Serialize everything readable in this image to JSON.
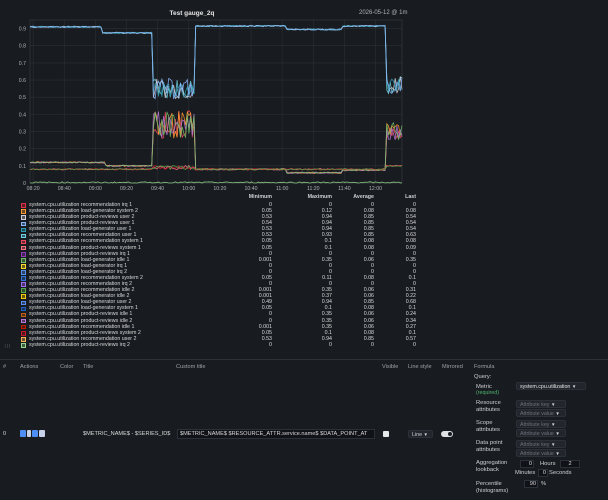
{
  "chart": {
    "title": "Test gauge_2q",
    "timestamp": "2026-05-12 @ 1m",
    "y_ticks": [
      "0.9",
      "0.8",
      "0.7",
      "0.6",
      "0.5",
      "0.4",
      "0.3",
      "0.2",
      "0.1",
      "0"
    ],
    "x_ticks": [
      "08:20",
      "08:40",
      "09:00",
      "09:20",
      "09:40",
      "10:00",
      "10:20",
      "10:40",
      "11:00",
      "11:20",
      "11:40",
      "12:00"
    ]
  },
  "chart_data": {
    "type": "line",
    "title": "Test gauge_2q",
    "x": [
      "08:20",
      "08:40",
      "09:00",
      "09:20",
      "09:40",
      "10:00",
      "10:20",
      "10:40",
      "11:00",
      "11:20",
      "11:40",
      "12:00"
    ],
    "ylim": [
      0,
      0.95
    ],
    "grid": true,
    "series": [
      {
        "name": "system.cpu.utilization recommendation user 1",
        "color": "#6ed0e0",
        "profile": "high"
      },
      {
        "name": "system.cpu.utilization product-reviews user 2",
        "color": "#cfcfd8",
        "profile": "high"
      },
      {
        "name": "system.cpu.utilization load-generator user 1",
        "color": "#2a9bb0",
        "profile": "high"
      },
      {
        "name": "system.cpu.utilization product-reviews user 1",
        "color": "#8ab8ff",
        "profile": "high"
      },
      {
        "name": "system.cpu.utilization recommendation system 1",
        "color": "#f2495c",
        "profile": "mid"
      },
      {
        "name": "system.cpu.utilization load-generator system 2",
        "color": "#ff9830",
        "profile": "mid"
      },
      {
        "name": "system.cpu.utilization product-reviews idle 2",
        "color": "#b877d9",
        "profile": "mid"
      },
      {
        "name": "system.cpu.utilization load-generator idle 1",
        "color": "#73bf69",
        "profile": "mid"
      },
      {
        "name": "system.cpu.utilization product-reviews system 1",
        "color": "#ff7383",
        "profile": "low"
      },
      {
        "name": "system.cpu.utilization product-reviews system 2",
        "color": "#c4162a",
        "profile": "low"
      },
      {
        "name": "system.cpu.utilization recommendation idle 2",
        "color": "#56a64b",
        "profile": "low"
      },
      {
        "name": "system.cpu.utilization product-reviews irq 2",
        "color": "#96d98d",
        "profile": "zero"
      }
    ]
  },
  "legend": {
    "headers": {
      "min": "Minimum",
      "max": "Maximum",
      "avg": "Average",
      "last": "Last"
    },
    "rows": [
      {
        "name": "system.cpu.utilization recommendation irq 1",
        "color": "#e02f44",
        "min": "0",
        "max": "0",
        "avg": "0",
        "last": "0"
      },
      {
        "name": "system.cpu.utilization load-generator system 2",
        "color": "#ff9830",
        "min": "0.05",
        "max": "0.12",
        "avg": "0.08",
        "last": "0.08"
      },
      {
        "name": "system.cpu.utilization product-reviews user 2",
        "color": "#cfcfd8",
        "min": "0.53",
        "max": "0.94",
        "avg": "0.85",
        "last": "0.54"
      },
      {
        "name": "system.cpu.utilization product-reviews user 1",
        "color": "#8ab8ff",
        "min": "0.54",
        "max": "0.94",
        "avg": "0.85",
        "last": "0.54"
      },
      {
        "name": "system.cpu.utilization load-generator user 1",
        "color": "#2a9bb0",
        "min": "0.53",
        "max": "0.94",
        "avg": "0.85",
        "last": "0.54"
      },
      {
        "name": "system.cpu.utilization recommendation user 1",
        "color": "#6ed0e0",
        "min": "0.53",
        "max": "0.93",
        "avg": "0.85",
        "last": "0.63"
      },
      {
        "name": "system.cpu.utilization recommendation system 1",
        "color": "#f2495c",
        "min": "0.05",
        "max": "0.1",
        "avg": "0.08",
        "last": "0.08"
      },
      {
        "name": "system.cpu.utilization product-reviews system 1",
        "color": "#ff7383",
        "min": "0.05",
        "max": "0.1",
        "avg": "0.08",
        "last": "0.09"
      },
      {
        "name": "system.cpu.utilization product-reviews irq 1",
        "color": "#8f3bb8",
        "min": "0",
        "max": "0",
        "avg": "0",
        "last": "0"
      },
      {
        "name": "system.cpu.utilization load-generator idle 1",
        "color": "#73bf69",
        "min": "0.001",
        "max": "0.35",
        "avg": "0.06",
        "last": "0.35"
      },
      {
        "name": "system.cpu.utilization load-generator irq 1",
        "color": "#fade2a",
        "min": "0",
        "max": "0",
        "avg": "0",
        "last": "0"
      },
      {
        "name": "system.cpu.utilization load-generator irq 2",
        "color": "#5794f2",
        "min": "0",
        "max": "0",
        "avg": "0",
        "last": "0"
      },
      {
        "name": "system.cpu.utilization recommendation system 2",
        "color": "#3274d9",
        "min": "0.05",
        "max": "0.11",
        "avg": "0.08",
        "last": "0.1"
      },
      {
        "name": "system.cpu.utilization recommendation irq 2",
        "color": "#a16efa",
        "min": "0",
        "max": "0",
        "avg": "0",
        "last": "0"
      },
      {
        "name": "system.cpu.utilization recommendation idle 2",
        "color": "#56a64b",
        "min": "0.001",
        "max": "0.35",
        "avg": "0.06",
        "last": "0.31"
      },
      {
        "name": "system.cpu.utilization load-generator idle 2",
        "color": "#f2cc0c",
        "min": "0.001",
        "max": "0.37",
        "avg": "0.06",
        "last": "0.22"
      },
      {
        "name": "system.cpu.utilization load-generator user 2",
        "color": "#5a8ff5",
        "min": "0.49",
        "max": "0.94",
        "avg": "0.85",
        "last": "0.68"
      },
      {
        "name": "system.cpu.utilization load-generator system 1",
        "color": "#1f60c4",
        "min": "0.05",
        "max": "0.1",
        "avg": "0.08",
        "last": "0.1"
      },
      {
        "name": "system.cpu.utilization product-reviews idle 1",
        "color": "#c15c17",
        "min": "0",
        "max": "0.35",
        "avg": "0.06",
        "last": "0.24"
      },
      {
        "name": "system.cpu.utilization product-reviews idle 2",
        "color": "#b877d9",
        "min": "0",
        "max": "0.35",
        "avg": "0.06",
        "last": "0.34"
      },
      {
        "name": "system.cpu.utilization recommendation idle 1",
        "color": "#bf1b00",
        "min": "0.001",
        "max": "0.35",
        "avg": "0.06",
        "last": "0.27"
      },
      {
        "name": "system.cpu.utilization product-reviews system 2",
        "color": "#c4162a",
        "min": "0.05",
        "max": "0.1",
        "avg": "0.08",
        "last": "0.1"
      },
      {
        "name": "system.cpu.utilization recommendation user 2",
        "color": "#ffb357",
        "min": "0.53",
        "max": "0.94",
        "avg": "0.85",
        "last": "0.57"
      },
      {
        "name": "system.cpu.utilization product-reviews irq 2",
        "color": "#96d98d",
        "min": "0",
        "max": "0",
        "avg": "0",
        "last": "0"
      }
    ]
  },
  "queries": {
    "headers": {
      "num": "#",
      "actions": "Actions",
      "color": "Color",
      "title": "Title",
      "custom_title": "Custom title",
      "visible": "Visible",
      "line_style": "Line style",
      "mirrored": "Mirrored",
      "formula": "Formula"
    },
    "row": {
      "index": "0",
      "title": "$METRIC_NAME$ - $SERIES_ID$",
      "custom_title": "$METRIC_NAME$ $RESOURCE_ATTR.service.name$ $DATA_POINT_AT",
      "line_style": "Line",
      "query_label": "Query:",
      "metric_label": "Metric",
      "metric_required": "(required)",
      "metric_value": "system.cpu.utilization",
      "resource_attr_label": "Resource attributes",
      "scope_attr_label": "Scope attributes",
      "datapoint_attr_label": "Data point attributes",
      "attr_key_placeholder": "Attribute key",
      "attr_value_placeholder": "Attribute value",
      "agg_label": "Aggregation lookback",
      "hours_value": "0",
      "hours_label": "Hours",
      "minutes_value": "2",
      "minutes_label": "Minutes",
      "seconds_value": "0",
      "seconds_label": "Seconds",
      "percentile_label": "Percentile (histograms)",
      "percentile_value": "90",
      "percentile_unit": "%"
    }
  }
}
